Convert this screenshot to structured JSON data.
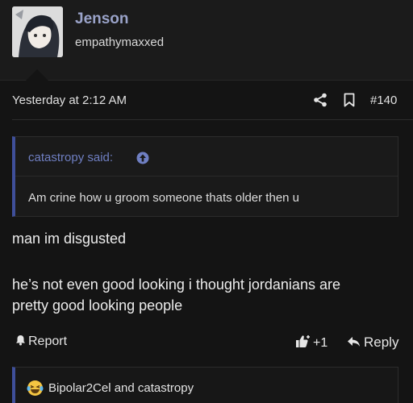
{
  "header": {
    "username": "Jenson",
    "user_title": "empathymaxxed",
    "avatar_icon": "anime-character-avatar"
  },
  "meta": {
    "timestamp": "Yesterday at 2:12 AM",
    "post_number": "#140",
    "share_icon": "share-icon",
    "bookmark_icon": "bookmark-icon"
  },
  "quote": {
    "author": "catastropy said:",
    "body": "Am crine how u groom someone thats older then u"
  },
  "message": {
    "lines": [
      "man im disgusted",
      "he’s not even good looking i thought jordanians are",
      "pretty good looking people"
    ]
  },
  "actions": {
    "report": "Report",
    "like": "+1",
    "reply": "Reply"
  },
  "reactions": {
    "emoji_icon": "laughing-crying-emoji",
    "text": "Bipolar2Cel and catastropy"
  },
  "colors": {
    "accent": "#3f4f9a",
    "username": "#9aa3c9",
    "quote_link": "#6f7fc2"
  }
}
